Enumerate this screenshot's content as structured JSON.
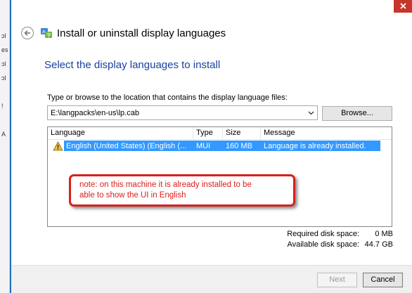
{
  "window": {
    "title": "Install or uninstall display languages",
    "close_glyph": "x"
  },
  "background": {
    "fragments": [
      "ɔl",
      "es",
      "ɔl",
      "ɔl",
      "ɔl",
      "!",
      "A"
    ]
  },
  "page": {
    "heading": "Select the display languages to install",
    "path_label": "Type or browse to the location that contains the display language files:",
    "path_value": "E:\\langpacks\\en-us\\lp.cab",
    "browse_label": "Browse..."
  },
  "table": {
    "headers": {
      "language": "Language",
      "type": "Type",
      "size": "Size",
      "message": "Message"
    },
    "rows": [
      {
        "language": "English (United States) (English (...",
        "type": "MUI",
        "size": "160 MB",
        "message": "Language is already installed.",
        "status_icon": "warning-icon"
      }
    ]
  },
  "note": {
    "line1": "note: on this machine it is already installed to be",
    "line2": "able to show the UI in English"
  },
  "disk": {
    "required_label": "Required disk space:",
    "required_value": "0 MB",
    "available_label": "Available disk space:",
    "available_value": "44.7 GB"
  },
  "footer": {
    "next_label": "Next",
    "cancel_label": "Cancel"
  },
  "colors": {
    "heading": "#1a3f9e",
    "selection": "#3399ff",
    "annotation": "#d8201b",
    "close": "#c7362b"
  }
}
